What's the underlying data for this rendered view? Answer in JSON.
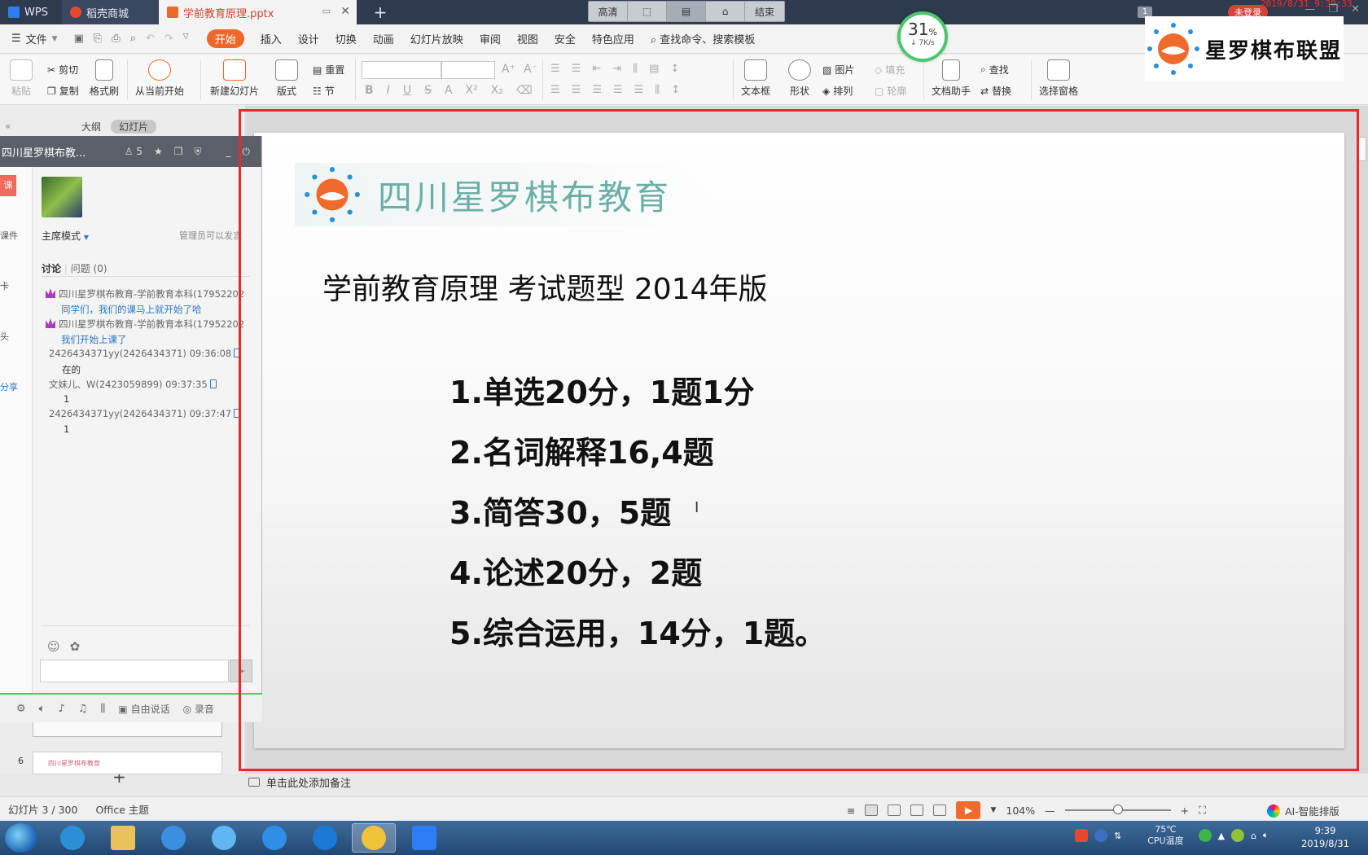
{
  "tabs": [
    {
      "label": "WPS"
    },
    {
      "label": "稻壳商城"
    },
    {
      "label": "学前教育原理.pptx"
    }
  ],
  "recorder": {
    "items": [
      "高清",
      "",
      "",
      "",
      "结束"
    ]
  },
  "titlebar": {
    "badge": "1",
    "unlogin": "未登录",
    "clock": "2019/8/31 9:39:33"
  },
  "menu": {
    "file": "文件",
    "items": [
      "开始",
      "插入",
      "设计",
      "切换",
      "动画",
      "幻灯片放映",
      "审阅",
      "视图",
      "安全",
      "特色应用"
    ],
    "search": "查找命令、搜索模板"
  },
  "speed": {
    "percent": "31",
    "unit": "%",
    "rate": "7K/s"
  },
  "watermark": {
    "text": "星罗棋布联盟"
  },
  "ribbon": {
    "paste": "粘贴",
    "cut": "剪切",
    "copy": "复制",
    "format_painter": "格式刷",
    "from_current": "从当前开始",
    "new_slide": "新建幻灯片",
    "layout": "版式",
    "reset": "重置",
    "section": "节",
    "textbox": "文本框",
    "shape": "形状",
    "picture": "图片",
    "fill": "填充",
    "arrange": "排列",
    "outline": "轮廓",
    "doc_helper": "文档助手",
    "find": "查找",
    "replace": "替换",
    "select_pane": "选择窗格"
  },
  "leftpanel": {
    "tab_outline": "大纲",
    "tab_slides": "幻灯片",
    "slide_number": "6",
    "thumb_text": "四川星罗棋布教育"
  },
  "chat": {
    "title": "四川星罗棋布教...",
    "member_count": "5",
    "side": [
      "课",
      "课件",
      "卡",
      "头",
      "分享"
    ],
    "mode": "主席模式",
    "admin_note": "管理员可以发言",
    "discuss": "讨论",
    "questions": "问题",
    "question_count": "(0)",
    "messages": [
      {
        "sender": "四川星罗棋布教育-学前教育本科(17952202",
        "text": "同学们，我们的课马上就开始了哈"
      },
      {
        "sender": "四川星罗棋布教育-学前教育本科(17952202",
        "text": "我们开始上课了"
      },
      {
        "sender": "2426434371yy(2426434371) 09:36:08",
        "text": "在的"
      },
      {
        "sender": "文妹儿、W(2423059899) 09:37:35",
        "text": "1"
      },
      {
        "sender": "2426434371yy(2426434371) 09:37:47",
        "text": "1"
      }
    ],
    "free_talk": "自由说话",
    "record": "录音"
  },
  "slide": {
    "org": "四川星罗棋布教育",
    "title": "学前教育原理  考试题型  2014年版",
    "items": [
      "1.单选20分，1题1分",
      "2.名词解释16,4题",
      "3.简答30，5题",
      "4.论述20分，2题",
      "5.综合运用，14分，1题。"
    ]
  },
  "notes": {
    "placeholder": "单击此处添加备注"
  },
  "status": {
    "slide_info": "幻灯片 3 / 300",
    "theme": "Office 主题",
    "zoom": "104%",
    "zoom_level": 0.5,
    "ai_layout": "AI-智能排版"
  },
  "taskbar": {
    "cpu_temp": "75℃",
    "cpu_label": "CPU温度",
    "time": "9:39",
    "date": "2019/8/31"
  }
}
